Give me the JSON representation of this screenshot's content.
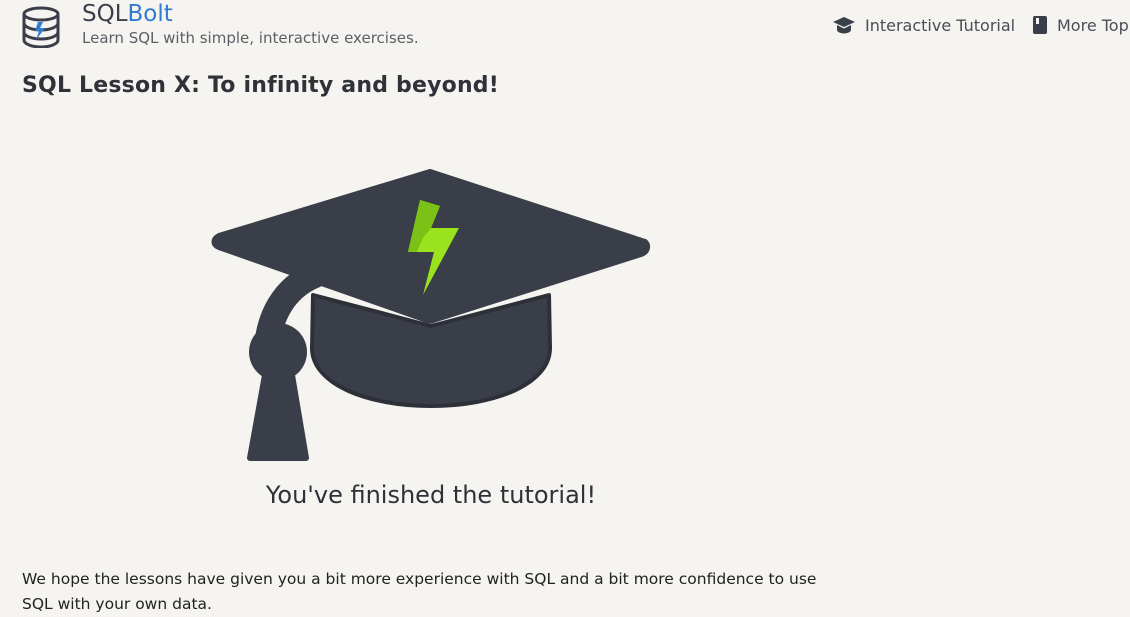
{
  "header": {
    "brand_prefix": "SQL",
    "brand_suffix": "Bolt",
    "tagline": "Learn SQL with simple, interactive exercises."
  },
  "nav": {
    "items": [
      {
        "label": "Interactive Tutorial",
        "icon": "graduation-cap-icon"
      },
      {
        "label": "More Topi",
        "icon": "book-icon"
      }
    ]
  },
  "lesson": {
    "title": "SQL Lesson X: To infinity and beyond!"
  },
  "main": {
    "finished_caption": "You've finished the tutorial!",
    "body": "We hope the lessons have given you a bit more experience with SQL and a bit more confidence to use SQL with your own data."
  },
  "colors": {
    "background": "#f5f4f0",
    "brand_accent": "#2f7bd2",
    "cap": "#3a3e48",
    "bolt": "#9be21e"
  }
}
